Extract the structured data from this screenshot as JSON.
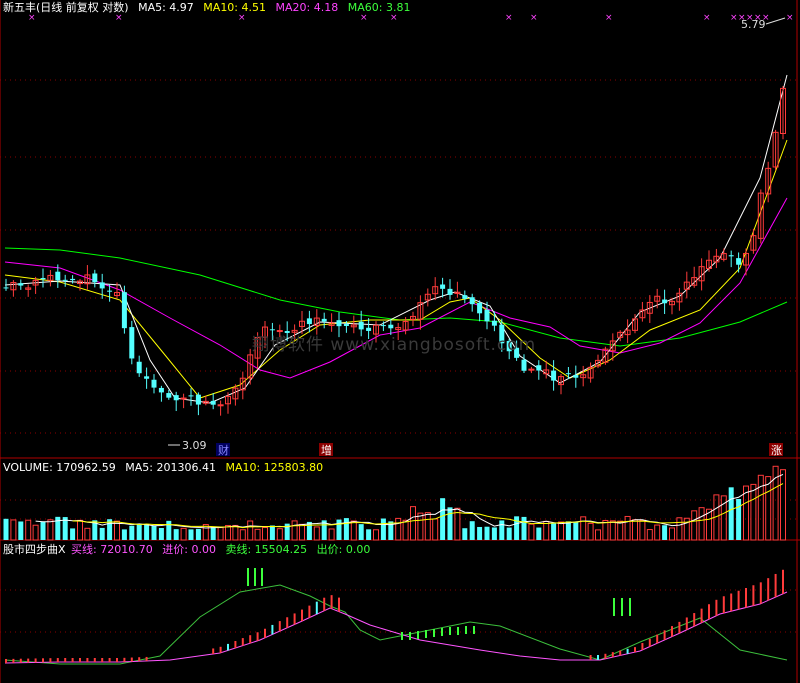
{
  "main_header": {
    "title": "新五丰(日线 前复权 对数)",
    "ma5": "MA5: 4.97",
    "ma10": "MA10: 4.51",
    "ma20": "MA20: 4.18",
    "ma60": "MA60: 3.81"
  },
  "volume_header": {
    "volume": "VOLUME: 170962.59",
    "ma5": "MA5: 201306.41",
    "ma10": "MA10: 125803.80"
  },
  "indicator_header": {
    "name": "股市四步曲X",
    "buy": "买线: 72010.70",
    "entry": "进价: 0.00",
    "sell": "卖线: 15504.25",
    "exit": "出价: 0.00"
  },
  "watermark": "翔博软件 www.xiangbosoft.com",
  "colors": {
    "background": "#000000",
    "up": "#ff3b3b",
    "down": "#54ffff",
    "ma5": "#ffffff",
    "ma10": "#ffff00",
    "ma20": "#ff00ff",
    "ma60": "#00ff00",
    "grid": "#8b0000"
  },
  "chart_data": [
    {
      "type": "candlestick",
      "title": "新五丰(日线 前复权 对数)",
      "scale": "log",
      "annotations": [
        {
          "text": "5.79",
          "kind": "high"
        },
        {
          "text": "3.09",
          "kind": "low"
        },
        {
          "text": "财",
          "kind": "event"
        },
        {
          "text": "增",
          "kind": "event"
        },
        {
          "text": "涨",
          "kind": "event"
        }
      ],
      "candle_count": 106
    },
    {
      "type": "bar",
      "title": "VOLUME",
      "series": [
        {
          "name": "VOLUME"
        },
        {
          "name": "MA5"
        },
        {
          "name": "MA10"
        }
      ]
    },
    {
      "type": "line",
      "title": "股市四步曲X",
      "series": [
        {
          "name": "买线"
        },
        {
          "name": "卖线"
        },
        {
          "name": "进价"
        },
        {
          "name": "出价"
        }
      ]
    }
  ]
}
